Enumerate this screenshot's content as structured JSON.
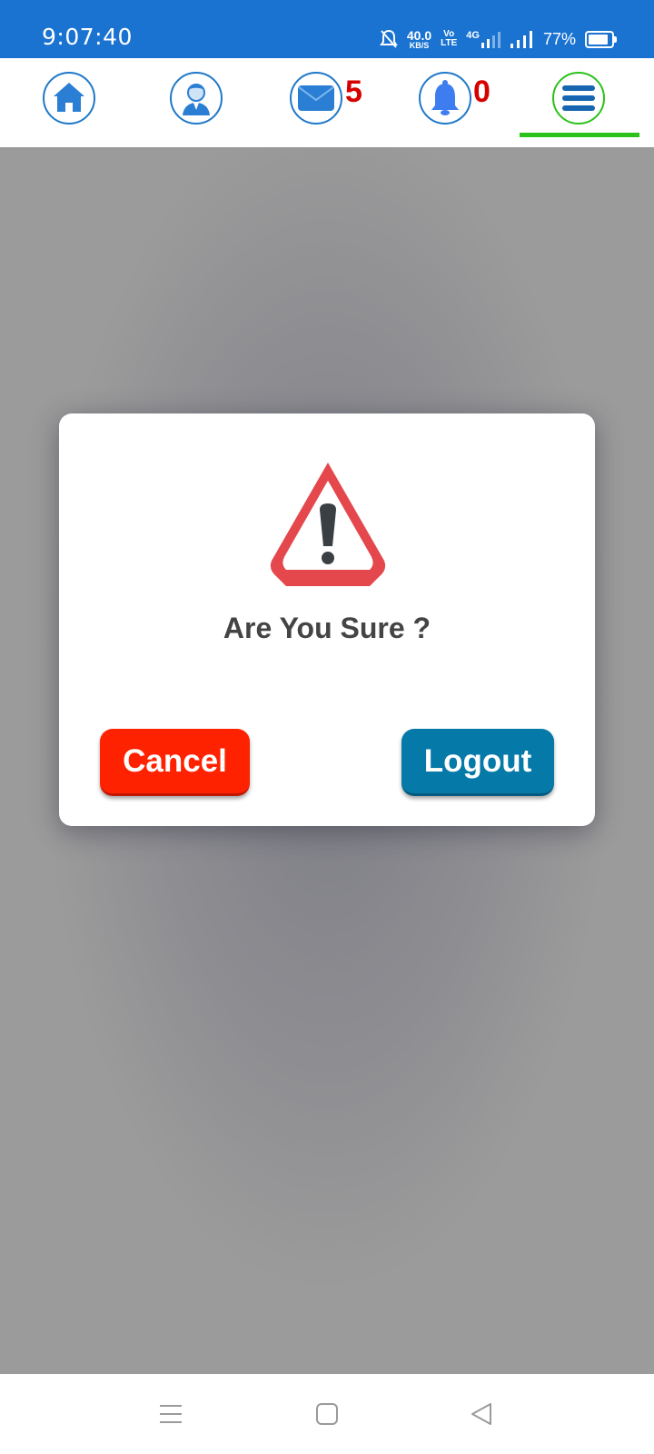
{
  "status_bar": {
    "time": "9:07:40",
    "net_speed_value": "40.0",
    "net_speed_unit": "KB/S",
    "volte_top": "Vo",
    "volte_bottom": "LTE",
    "network_type": "4G",
    "battery_percent": "77%",
    "background_color": "#1a73d1"
  },
  "top_nav": {
    "items": [
      {
        "name": "home",
        "icon": "home-icon"
      },
      {
        "name": "profile",
        "icon": "user-avatar-icon"
      },
      {
        "name": "messages",
        "icon": "mail-icon",
        "badge": "5"
      },
      {
        "name": "notifications",
        "icon": "bell-icon",
        "badge": "0"
      },
      {
        "name": "menu",
        "icon": "hamburger-menu-icon",
        "active": true
      }
    ],
    "active_underline_color": "#2bc21a",
    "badge_color": "#d60000"
  },
  "dialog": {
    "icon": "warning-triangle-icon",
    "title": "Are You Sure ?",
    "cancel_label": "Cancel",
    "logout_label": "Logout",
    "cancel_color": "#ff2200",
    "logout_color": "#0579a8"
  },
  "system_nav": {
    "buttons": [
      "recent-apps-icon",
      "home-square-icon",
      "back-triangle-icon"
    ]
  }
}
